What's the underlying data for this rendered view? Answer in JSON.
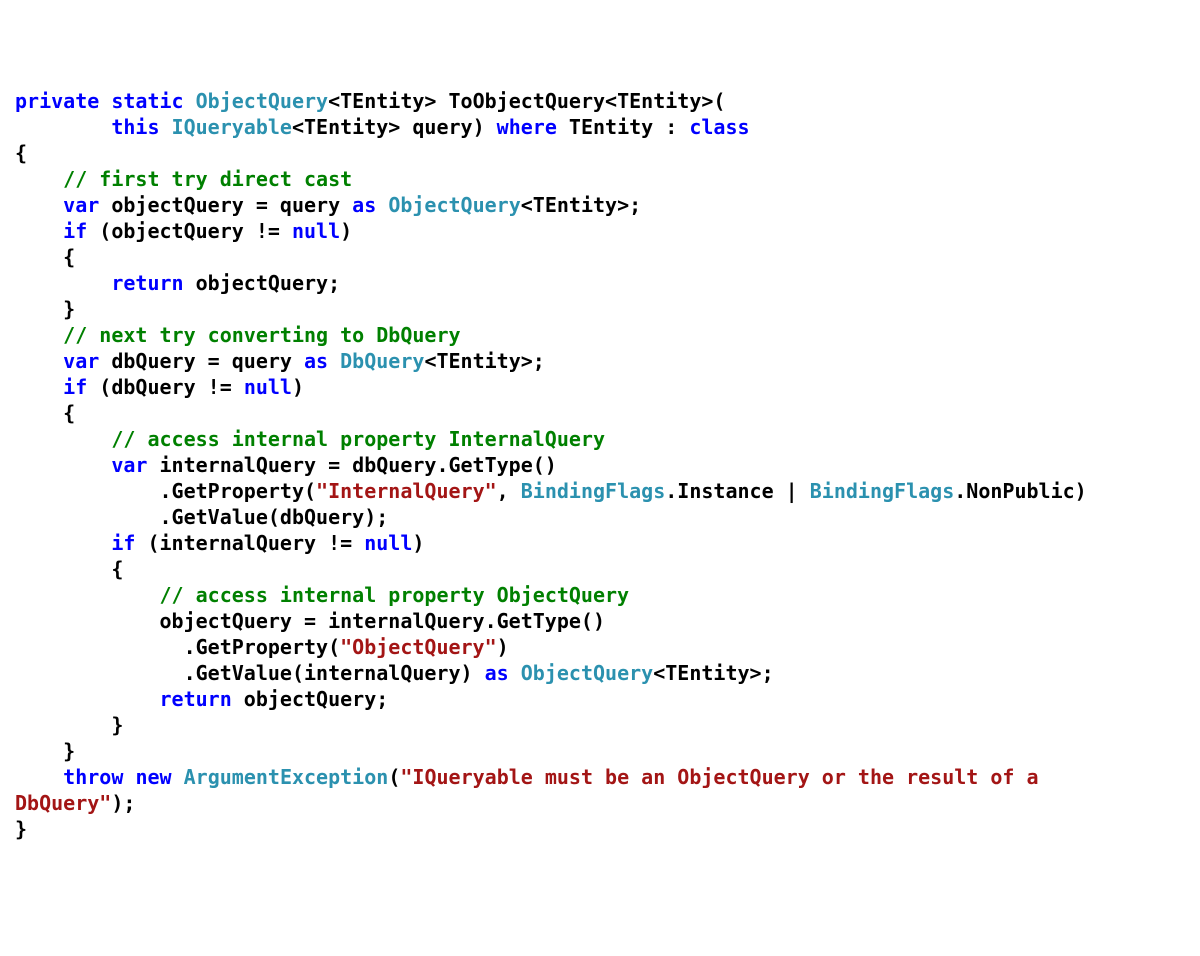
{
  "code": {
    "tokens": [
      [
        [
          "kw",
          "private"
        ],
        [
          "pln",
          " "
        ],
        [
          "kw",
          "static"
        ],
        [
          "pln",
          " "
        ],
        [
          "typ",
          "ObjectQuery"
        ],
        [
          "pln",
          "<TEntity> ToObjectQuery<TEntity>("
        ]
      ],
      [
        [
          "pln",
          "        "
        ],
        [
          "kw",
          "this"
        ],
        [
          "pln",
          " "
        ],
        [
          "typ",
          "IQueryable"
        ],
        [
          "pln",
          "<TEntity> query) "
        ],
        [
          "kw",
          "where"
        ],
        [
          "pln",
          " TEntity : "
        ],
        [
          "kw",
          "class"
        ]
      ],
      [
        [
          "pln",
          "{"
        ]
      ],
      [
        [
          "pln",
          "    "
        ],
        [
          "cmt",
          "// first try direct cast"
        ]
      ],
      [
        [
          "pln",
          "    "
        ],
        [
          "kw",
          "var"
        ],
        [
          "pln",
          " objectQuery = query "
        ],
        [
          "kw",
          "as"
        ],
        [
          "pln",
          " "
        ],
        [
          "typ",
          "ObjectQuery"
        ],
        [
          "pln",
          "<TEntity>;"
        ]
      ],
      [
        [
          "pln",
          "    "
        ],
        [
          "kw",
          "if"
        ],
        [
          "pln",
          " (objectQuery != "
        ],
        [
          "kw",
          "null"
        ],
        [
          "pln",
          ")"
        ]
      ],
      [
        [
          "pln",
          "    {"
        ]
      ],
      [
        [
          "pln",
          "        "
        ],
        [
          "kw",
          "return"
        ],
        [
          "pln",
          " objectQuery;"
        ]
      ],
      [
        [
          "pln",
          "    }"
        ]
      ],
      [
        [
          "pln",
          "    "
        ],
        [
          "cmt",
          "// next try converting to DbQuery"
        ]
      ],
      [
        [
          "pln",
          "    "
        ],
        [
          "kw",
          "var"
        ],
        [
          "pln",
          " dbQuery = query "
        ],
        [
          "kw",
          "as"
        ],
        [
          "pln",
          " "
        ],
        [
          "typ",
          "DbQuery"
        ],
        [
          "pln",
          "<TEntity>;"
        ]
      ],
      [
        [
          "pln",
          "    "
        ],
        [
          "kw",
          "if"
        ],
        [
          "pln",
          " (dbQuery != "
        ],
        [
          "kw",
          "null"
        ],
        [
          "pln",
          ")"
        ]
      ],
      [
        [
          "pln",
          "    {"
        ]
      ],
      [
        [
          "pln",
          "        "
        ],
        [
          "cmt",
          "// access internal property InternalQuery"
        ]
      ],
      [
        [
          "pln",
          "        "
        ],
        [
          "kw",
          "var"
        ],
        [
          "pln",
          " internalQuery = dbQuery.GetType()"
        ]
      ],
      [
        [
          "pln",
          "            .GetProperty("
        ],
        [
          "str",
          "\"InternalQuery\""
        ],
        [
          "pln",
          ", "
        ],
        [
          "typ",
          "BindingFlags"
        ],
        [
          "pln",
          ".Instance | "
        ],
        [
          "typ",
          "BindingFlags"
        ],
        [
          "pln",
          ".NonPublic)"
        ]
      ],
      [
        [
          "pln",
          "            .GetValue(dbQuery);"
        ]
      ],
      [
        [
          "pln",
          "        "
        ],
        [
          "kw",
          "if"
        ],
        [
          "pln",
          " (internalQuery != "
        ],
        [
          "kw",
          "null"
        ],
        [
          "pln",
          ")"
        ]
      ],
      [
        [
          "pln",
          "        {"
        ]
      ],
      [
        [
          "pln",
          "            "
        ],
        [
          "cmt",
          "// access internal property ObjectQuery"
        ]
      ],
      [
        [
          "pln",
          "            objectQuery = internalQuery.GetType()"
        ]
      ],
      [
        [
          "pln",
          "              .GetProperty("
        ],
        [
          "str",
          "\"ObjectQuery\""
        ],
        [
          "pln",
          ")"
        ]
      ],
      [
        [
          "pln",
          "              .GetValue(internalQuery) "
        ],
        [
          "kw",
          "as"
        ],
        [
          "pln",
          " "
        ],
        [
          "typ",
          "ObjectQuery"
        ],
        [
          "pln",
          "<TEntity>;"
        ]
      ],
      [
        [
          "pln",
          "            "
        ],
        [
          "kw",
          "return"
        ],
        [
          "pln",
          " objectQuery;"
        ]
      ],
      [
        [
          "pln",
          "        }"
        ]
      ],
      [
        [
          "pln",
          "    }"
        ]
      ],
      [
        [
          "pln",
          "    "
        ],
        [
          "kw",
          "throw"
        ],
        [
          "pln",
          " "
        ],
        [
          "kw",
          "new"
        ],
        [
          "pln",
          " "
        ],
        [
          "typ",
          "ArgumentException"
        ],
        [
          "pln",
          "("
        ],
        [
          "str",
          "\"IQueryable must be an ObjectQuery or the result of a "
        ]
      ],
      [
        [
          "str",
          "DbQuery\""
        ],
        [
          "pln",
          ");"
        ]
      ],
      [
        [
          "pln",
          "}"
        ]
      ]
    ]
  }
}
